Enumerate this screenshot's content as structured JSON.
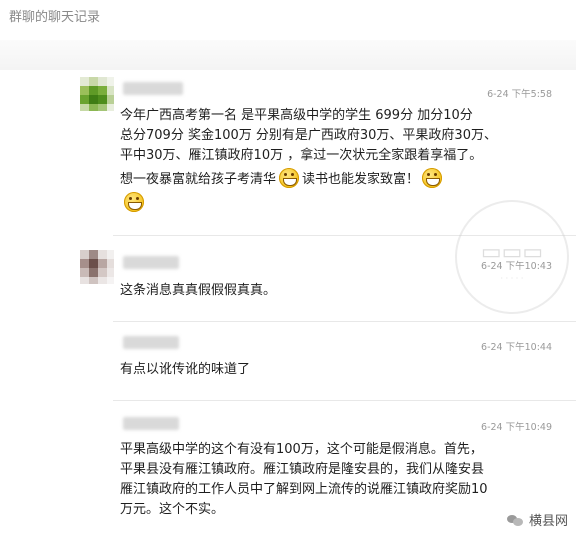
{
  "window": {
    "title": "群聊的聊天记录"
  },
  "messages": [
    {
      "time": "6-24 下午5:58",
      "lines": [
        "今年广西高考第一名  是平果高级中学的学生  699分  加分10分",
        "总分709分  奖金100万  分别有是广西政府30万、平果政府30万、",
        "平中30万、雁江镇政府10万  ，拿过一次状元全家跟着享福了。"
      ],
      "line4a": "想一夜暴富就给孩子考清华",
      "line4b": "读书也能发家致富！"
    },
    {
      "time": "6-24 下午10:43",
      "lines": [
        "这条消息真真假假假真真。"
      ]
    },
    {
      "time": "6-24 下午10:44",
      "lines": [
        "有点以讹传讹的味道了"
      ]
    },
    {
      "time": "6-24 下午10:49",
      "lines": [
        "平果高级中学的这个有没有100万，这个可能是假消息。首先，",
        "平果县没有雁江镇政府。雁江镇政府是隆安县的，我们从隆安县",
        "雁江镇政府的工作人员中了解到网上流传的说雁江镇政府奖励10",
        "万元。这个不实。"
      ]
    }
  ],
  "icons": {
    "emoji": "grinning-face-icon",
    "brand_logo": "wechat-logo-icon"
  },
  "brand": {
    "name": "横县网"
  },
  "colors": {
    "text": "#1e1e1e",
    "time": "#9a9a9a",
    "divider": "#e8e8e8"
  }
}
